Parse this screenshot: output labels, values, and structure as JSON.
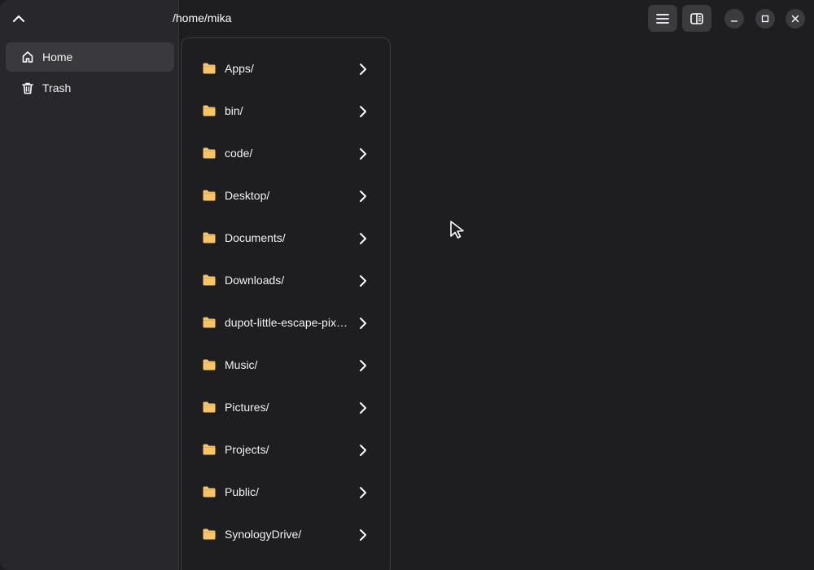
{
  "header": {
    "path": "/home/mika"
  },
  "sidebar": {
    "items": [
      {
        "label": "Home",
        "icon": "home-icon",
        "selected": true
      },
      {
        "label": "Trash",
        "icon": "trash-icon",
        "selected": false
      }
    ]
  },
  "column": {
    "entries": [
      {
        "label": "Apps/"
      },
      {
        "label": "bin/"
      },
      {
        "label": "code/"
      },
      {
        "label": "Desktop/"
      },
      {
        "label": "Documents/"
      },
      {
        "label": "Downloads/"
      },
      {
        "label": "dupot-little-escape-pixel-art/"
      },
      {
        "label": "Music/"
      },
      {
        "label": "Pictures/"
      },
      {
        "label": "Projects/"
      },
      {
        "label": "Public/"
      },
      {
        "label": "SynologyDrive/"
      }
    ]
  },
  "colors": {
    "background": "#1e1e21",
    "sidebar": "#28282c",
    "folder": "#f8c46a",
    "button": "#3b3b3f"
  }
}
